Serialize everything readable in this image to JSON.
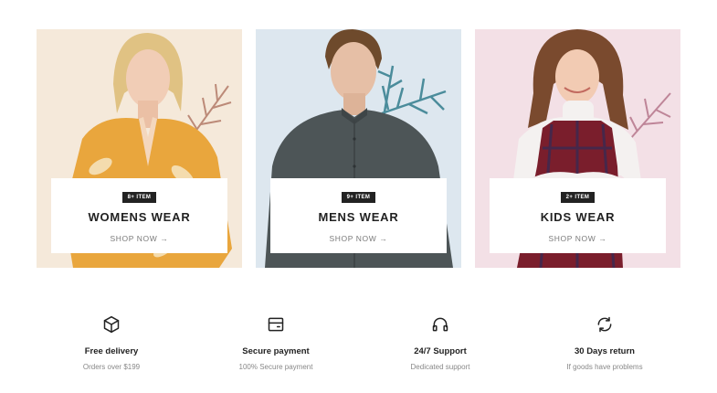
{
  "categories": [
    {
      "badge": "8+ ITEM",
      "title": "WOMENS WEAR",
      "link": "SHOP NOW",
      "link_arrow": "→"
    },
    {
      "badge": "9+ ITEM",
      "title": "MENS WEAR",
      "link": "SHOP NOW",
      "link_arrow": "→"
    },
    {
      "badge": "2+ ITEM",
      "title": "KIDS WEAR",
      "link": "SHOP NOW",
      "link_arrow": "→"
    }
  ],
  "features": [
    {
      "icon": "box-icon",
      "title": "Free delivery",
      "subtitle": "Orders over $199"
    },
    {
      "icon": "credit-card-icon",
      "title": "Secure payment",
      "subtitle": "100% Secure payment"
    },
    {
      "icon": "headphones-icon",
      "title": "24/7 Support",
      "subtitle": "Dedicated support"
    },
    {
      "icon": "refresh-icon",
      "title": "30 Days return",
      "subtitle": "If goods have problems"
    }
  ],
  "colors": {
    "womens_bg": "#f5e9da",
    "mens_bg": "#dde7ef",
    "kids_bg": "#f3e0e6",
    "badge_bg": "#222222",
    "text_dark": "#222222",
    "text_muted": "#888888"
  }
}
